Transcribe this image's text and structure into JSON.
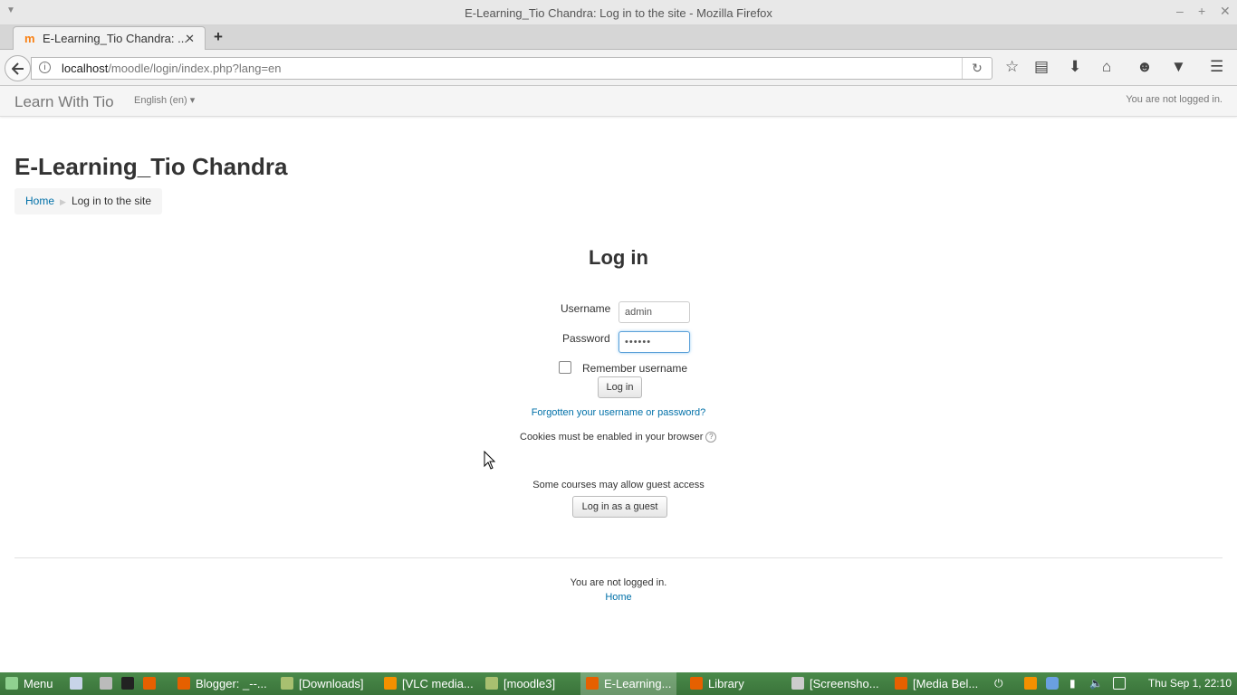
{
  "window": {
    "title": "E-Learning_Tio Chandra: Log in to the site - Mozilla Firefox"
  },
  "browser": {
    "tab_title": "E-Learning_Tio Chandra: ...",
    "tab_close": "✕",
    "new_tab": "+",
    "url_host": "localhost",
    "url_path": "/moodle/login/index.php?lang=en",
    "toolbar_icons": [
      "star-icon",
      "reading-list-icon",
      "download-icon",
      "home-icon",
      "chat-icon",
      "pocket-icon",
      "hamburger-menu-icon"
    ]
  },
  "moodle_nav": {
    "brand": "Learn With Tio",
    "language": "English (en) ▾",
    "login_info": "You are not logged in."
  },
  "page": {
    "site_title": "E-Learning_Tio Chandra",
    "breadcrumb": [
      "Home",
      "Log in to the site"
    ]
  },
  "login": {
    "heading": "Log in",
    "username_label": "Username",
    "username_value": "admin",
    "password_label": "Password",
    "password_value": "••••••",
    "remember_label": "Remember username",
    "login_button": "Log in",
    "forgot_link": "Forgotten your username or password?",
    "cookies_text": "Cookies must be enabled in your browser",
    "help_icon": "?",
    "guest_text": "Some courses may allow guest access",
    "guest_button": "Log in as a guest"
  },
  "footer": {
    "login_info": "You are not logged in.",
    "home_link": "Home"
  },
  "taskbar": {
    "menu_label": "Menu",
    "items": [
      {
        "label": "Blogger: _--...",
        "icon": "firefox-icon"
      },
      {
        "label": "[Downloads]",
        "icon": "folder-icon"
      },
      {
        "label": "[VLC media...",
        "icon": "vlc-icon"
      },
      {
        "label": "[moodle3]",
        "icon": "folder-icon"
      },
      {
        "label": "E-Learning...",
        "icon": "firefox-icon"
      },
      {
        "label": "Library",
        "icon": "firefox-icon"
      },
      {
        "label": "[Screensho...",
        "icon": "screenshot-icon"
      },
      {
        "label": "[Media Bel...",
        "icon": "firefox-icon"
      }
    ],
    "clock": "Thu Sep  1, 22:10"
  },
  "colors": {
    "link": "#0070a8",
    "taskbar": "#3f7d3f",
    "moodle_orange": "#f98012"
  }
}
